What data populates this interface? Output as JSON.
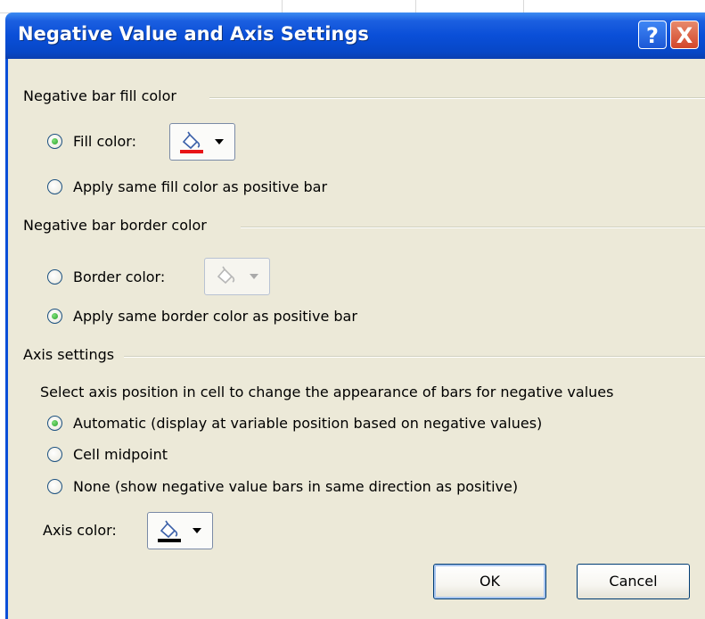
{
  "dialog": {
    "title": "Negative Value and Axis Settings",
    "help_glyph": "?",
    "close_glyph": "X"
  },
  "fill_group": {
    "label": "Negative bar fill color",
    "options": [
      {
        "label": "Fill color:",
        "checked": true
      },
      {
        "label": "Apply same fill color as positive bar",
        "checked": false
      }
    ],
    "fill_color_swatch": "#e81416"
  },
  "border_group": {
    "label": "Negative bar border color",
    "options": [
      {
        "label": "Border color:",
        "checked": false
      },
      {
        "label": "Apply same border color as positive bar",
        "checked": true
      }
    ],
    "border_color_enabled": false
  },
  "axis_group": {
    "label": "Axis settings",
    "description": "Select axis position in cell to change the appearance of bars for negative values",
    "options": [
      {
        "label": "Automatic (display at variable position based on negative values)",
        "checked": true
      },
      {
        "label": "Cell midpoint",
        "checked": false
      },
      {
        "label": "None (show negative value bars in same direction as positive)",
        "checked": false
      }
    ],
    "axis_color_label": "Axis color:",
    "axis_color_swatch": "#000000"
  },
  "buttons": {
    "ok": "OK",
    "cancel": "Cancel"
  },
  "colors": {
    "title_bar": "#0a4fd8",
    "dialog_face": "#ece9d8",
    "radio_dot": "#2aa12a"
  }
}
